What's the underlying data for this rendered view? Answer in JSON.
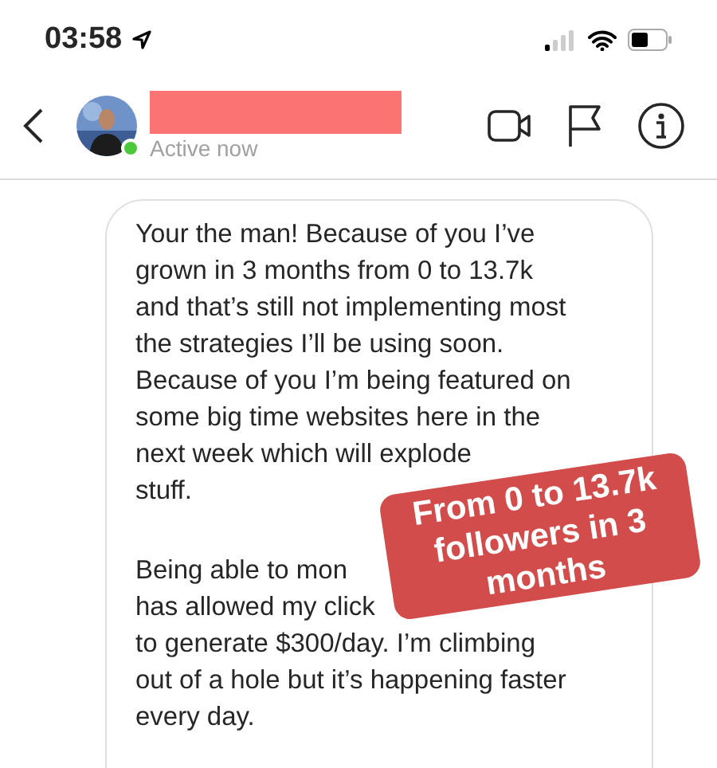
{
  "status_bar": {
    "time": "03:58"
  },
  "header": {
    "online": true,
    "status": "Active now"
  },
  "message": {
    "paragraphs": [
      [
        "Your the man! Because of you I’ve",
        "grown in 3 months from 0 to 13.7k",
        "and that’s still not implementing most",
        "the strategies I’ll be using soon.",
        "Because of you I’m being featured on",
        "some big time websites here in the",
        "next week which will explode",
        "stuff."
      ],
      [
        "Being able to mon",
        "has allowed my click",
        "to generate $300/day. I’m climbing",
        "out of a hole but it’s happening faster",
        "every day."
      ]
    ]
  },
  "sticker": {
    "lines": [
      "From 0 to 13.7k",
      "followers in 3",
      "months"
    ]
  }
}
